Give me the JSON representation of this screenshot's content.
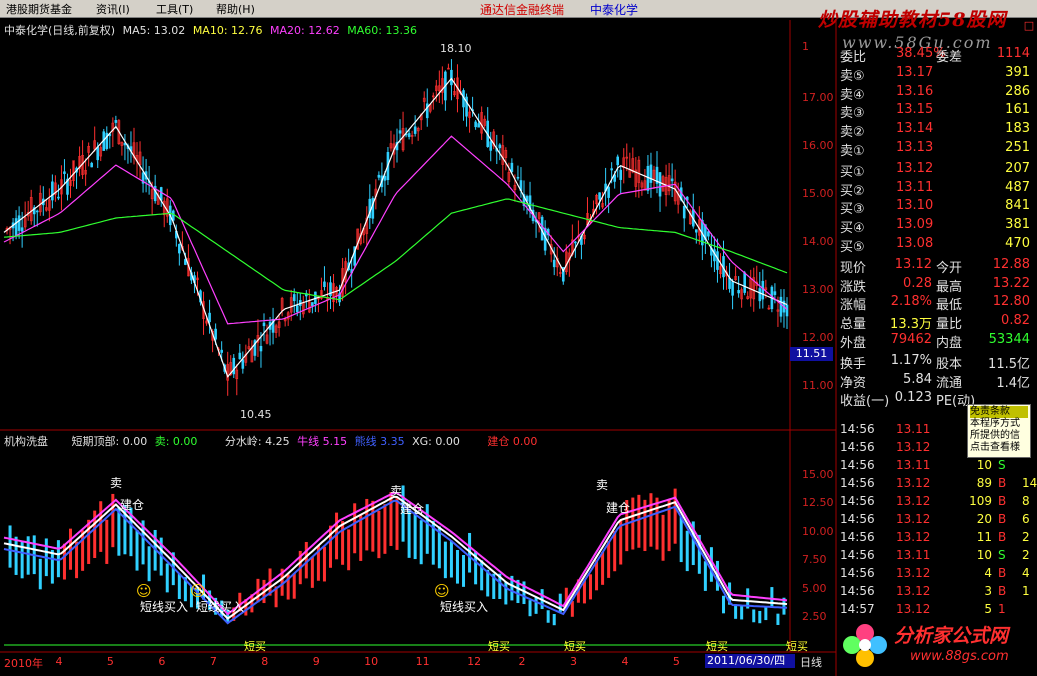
{
  "menu": [
    "港股期货基金",
    "资讯(I)",
    "工具(T)",
    "帮助(H)"
  ],
  "app": {
    "title": "通达信金融终端",
    "stock": "中泰化学",
    "watermark": "炒股辅助教材58股网",
    "watermark_url": "www.58Gu.com",
    "close": "□"
  },
  "main_legend": {
    "title": "中泰化学(日线,前复权)",
    "ma5": "MA5: 13.02",
    "ma10": "MA10: 12.76",
    "ma20": "MA20: 12.62",
    "ma60": "MA60: 13.36"
  },
  "price_axis": [
    "17.00",
    "16.00",
    "15.00",
    "14.00",
    "13.00",
    "12.00",
    "11.00"
  ],
  "price_axis_top": "1",
  "price_tag": "11.51",
  "high_mark": "18.10",
  "low_mark": "10.45",
  "ind_legend": {
    "name": "机构洗盘",
    "dtop": "短期顶部: 0.00",
    "sell": "卖: 0.00",
    "fsl": "分水岭: 4.25",
    "bull": "牛线 5.15",
    "bear": "熊线 3.35",
    "xg": "XG: 0.00",
    "build": "建仓 0.00"
  },
  "ind_axis": [
    "15.00",
    "12.50",
    "10.00",
    "7.50",
    "5.00",
    "2.50"
  ],
  "x_axis": [
    "2010年",
    "4",
    "5",
    "6",
    "7",
    "8",
    "9",
    "10",
    "11",
    "12",
    "2",
    "3",
    "4",
    "5",
    "6"
  ],
  "date_tag": "2011/06/30/四",
  "daily": "日线",
  "signals": [
    "卖",
    "建仓",
    "卖",
    "建仓",
    "卖",
    "建仓",
    "短线买入",
    "短线买入",
    "短线买入",
    "短买",
    "短买",
    "短买",
    "短买",
    "短买"
  ],
  "ratio": {
    "label": "委比",
    "value": "38.45%",
    "label2": "委差",
    "value2": "1114"
  },
  "sells": [
    {
      "label": "卖⑤",
      "price": "13.17",
      "vol": "391"
    },
    {
      "label": "卖④",
      "price": "13.16",
      "vol": "286"
    },
    {
      "label": "卖③",
      "price": "13.15",
      "vol": "161"
    },
    {
      "label": "卖②",
      "price": "13.14",
      "vol": "183"
    },
    {
      "label": "卖①",
      "price": "13.13",
      "vol": "251"
    }
  ],
  "buys": [
    {
      "label": "买①",
      "price": "13.12",
      "vol": "207"
    },
    {
      "label": "买②",
      "price": "13.11",
      "vol": "487"
    },
    {
      "label": "买③",
      "price": "13.10",
      "vol": "841"
    },
    {
      "label": "买④",
      "price": "13.09",
      "vol": "381"
    },
    {
      "label": "买⑤",
      "price": "13.08",
      "vol": "470"
    }
  ],
  "quote": [
    {
      "l1": "现价",
      "v1": "13.12",
      "l2": "今开",
      "v2": "12.88"
    },
    {
      "l1": "涨跌",
      "v1": "0.28",
      "l2": "最高",
      "v2": "13.22"
    },
    {
      "l1": "涨幅",
      "v1": "2.18%",
      "l2": "最低",
      "v2": "12.80"
    },
    {
      "l1": "总量",
      "v1": "13.3万",
      "l2": "量比",
      "v2": "0.82"
    },
    {
      "l1": "外盘",
      "v1": "79462",
      "l2": "内盘",
      "v2": "53344"
    }
  ],
  "finance": [
    {
      "l1": "换手",
      "v1": "1.17%",
      "l2": "股本",
      "v2": "11.5亿"
    },
    {
      "l1": "净资",
      "v1": "5.84",
      "l2": "流通",
      "v2": "1.4亿"
    },
    {
      "l1": "收益(一)",
      "v1": "0.123",
      "l2": "PE(动)",
      "v2": ""
    }
  ],
  "ticks": [
    {
      "time": "14:56",
      "price": "13.11",
      "vol": "",
      "side": ""
    },
    {
      "time": "14:56",
      "price": "13.12",
      "vol": "",
      "side": ""
    },
    {
      "time": "14:56",
      "price": "13.11",
      "vol": "10",
      "side": "S"
    },
    {
      "time": "14:56",
      "price": "13.12",
      "vol": "89",
      "side": "B"
    },
    {
      "time": "14:56",
      "price": "13.12",
      "vol": "109",
      "side": "B"
    },
    {
      "time": "14:56",
      "price": "13.12",
      "vol": "20",
      "side": "B"
    },
    {
      "time": "14:56",
      "price": "13.12",
      "vol": "11",
      "side": "B"
    },
    {
      "time": "14:56",
      "price": "13.11",
      "vol": "10",
      "side": "S"
    },
    {
      "time": "14:56",
      "price": "13.12",
      "vol": "4",
      "side": "B"
    },
    {
      "time": "14:56",
      "price": "13.12",
      "vol": "3",
      "side": "B"
    },
    {
      "time": "14:57",
      "price": "13.12",
      "vol": "5",
      "side": "1"
    }
  ],
  "tick_tail": [
    "",
    "",
    "",
    "14",
    "8",
    "6",
    "2",
    "2",
    "4",
    "1",
    ""
  ],
  "tooltip": {
    "title": "免责条款",
    "lines": [
      "本程序方式",
      "所提供的信",
      "点击查看様"
    ]
  },
  "logo": {
    "title": "分析家公式网",
    "url": "www.88gs.com"
  },
  "colors": {
    "up": "#ff3030",
    "down": "#30d0ff",
    "ma5": "#ffffff",
    "ma10": "#ffff30",
    "ma20": "#ff40ff",
    "ma60": "#30ff30"
  },
  "chart_data": [
    {
      "type": "line",
      "title": "中泰化学(日线,前复权)",
      "xlabel": "",
      "ylabel": "",
      "ylim": [
        10.3,
        18.2
      ],
      "categories": [
        "2010年",
        "4",
        "5",
        "6",
        "7",
        "8",
        "9",
        "10",
        "11",
        "12",
        "2",
        "3",
        "4",
        "5",
        "6"
      ],
      "series": [
        {
          "name": "MA5",
          "values": [
            14.2,
            15.1,
            16.4,
            14.5,
            11.2,
            12.6,
            13.0,
            16.0,
            17.4,
            15.6,
            13.4,
            15.6,
            15.1,
            13.2,
            12.7
          ]
        },
        {
          "name": "MA20",
          "values": [
            14.0,
            14.6,
            15.6,
            14.9,
            12.3,
            12.4,
            12.9,
            15.0,
            16.2,
            15.2,
            13.8,
            15.0,
            15.2,
            13.6,
            12.6
          ]
        },
        {
          "name": "MA60",
          "values": [
            14.1,
            14.2,
            14.5,
            14.6,
            13.8,
            13.0,
            12.8,
            13.6,
            14.6,
            14.9,
            14.6,
            14.3,
            14.2,
            13.8,
            13.36
          ]
        }
      ]
    },
    {
      "type": "line",
      "title": "机构洗盘",
      "xlabel": "",
      "ylabel": "",
      "ylim": [
        0,
        17
      ],
      "categories": [
        "2010年",
        "4",
        "5",
        "6",
        "7",
        "8",
        "9",
        "10",
        "11",
        "12",
        "2",
        "3",
        "4",
        "5",
        "6"
      ],
      "series": [
        {
          "name": "牛线",
          "values": [
            9.5,
            8.5,
            12.8,
            8.0,
            2.8,
            6.5,
            11.0,
            13.5,
            10.0,
            6.0,
            3.5,
            11.5,
            13.0,
            4.5,
            4.0
          ]
        },
        {
          "name": "熊线",
          "values": [
            8.5,
            7.5,
            12.0,
            7.0,
            2.0,
            5.5,
            10.0,
            12.8,
            9.2,
            5.0,
            2.8,
            10.5,
            12.2,
            3.6,
            3.35
          ]
        }
      ]
    }
  ]
}
